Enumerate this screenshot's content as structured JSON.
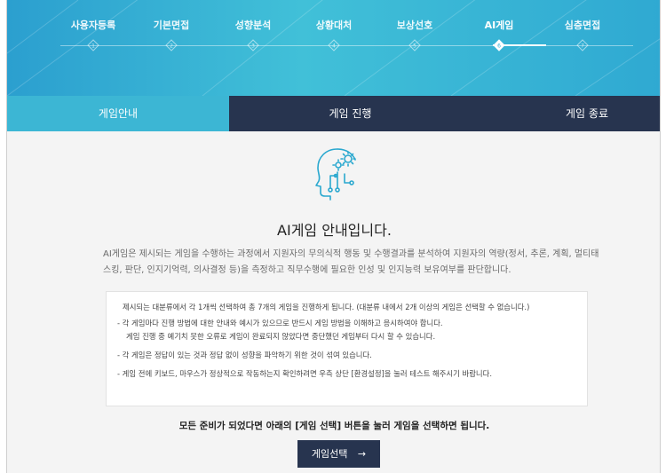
{
  "steps": [
    {
      "label": "사용자등록",
      "number": "1"
    },
    {
      "label": "기본면접",
      "number": "2"
    },
    {
      "label": "성향분석",
      "number": "3"
    },
    {
      "label": "상황대처",
      "number": "4"
    },
    {
      "label": "보상선호",
      "number": "5"
    },
    {
      "label": "AI게임",
      "number": "6"
    },
    {
      "label": "심층면접",
      "number": "7"
    }
  ],
  "active_step": 6,
  "tabs": {
    "guide": "게임안내",
    "progress": "게임 진행",
    "end": "게임 종료"
  },
  "content": {
    "icon": "ai-head-gears-icon",
    "title": "AI게임 안내입니다.",
    "description": "AI게임은 제시되는 게임을 수행하는 과정에서 지원자의 무의식적 행동 및 수행결과를 분석하여 지원자의 역량(정서, 추론, 계획, 멀티태스킹, 판단, 인지기억력, 의사결정 등)을 측정하고 직무수행에 필요한 인성 및 인지능력 보유여부를 판단합니다.",
    "notices": {
      "n1": "제시되는 대분류에서 각 1개씩 선택하여 총 7개의 게임을 진행하게 됩니다. (대분류 내에서 2개 이상의 게임은 선택할 수 없습니다.)",
      "n2": "- 각 게임마다 진행 방법에 대한 안내와 예시가 있으므로 반드시 게임 방법을 이해하고 응시하여야 합니다.",
      "n2b": "게임 진행 중 예기치 못한 오류로 게임이 완료되지 않았다면 중단했던 게임부터 다시 할 수 있습니다.",
      "n3": "- 각 게임은 정답이 있는 것과 정답 없이 성향을 파악하기 위한 것이 섞여 있습니다.",
      "n4": "- 게임 전에 키보드, 마우스가 정상적으로 작동하는지 확인하려면 우측 상단 [환경설정]을 눌러 테스트 해주시기 바랍니다."
    },
    "ready_text": "모든 준비가 되었다면 아래의 [게임 선택] 버튼을 눌러 게임을 선택하면 됩니다.",
    "button_label": "게임선택",
    "button_arrow": "→"
  },
  "colors": {
    "header_gradient_start": "#2b9fcf",
    "header_gradient_end": "#41c0d8",
    "tab_active": "#3cb6d4",
    "tab_inactive": "#27344f",
    "button": "#27344f"
  }
}
